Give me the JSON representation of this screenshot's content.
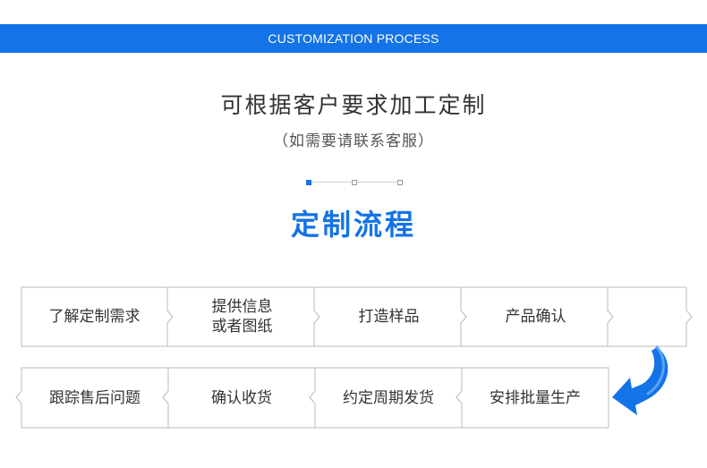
{
  "banner": {
    "label": "CUSTOMIZATION PROCESS"
  },
  "heading": {
    "title": "可根据客户要求加工定制",
    "subtitle": "（如需要请联系客服）"
  },
  "process": {
    "title": "定制流程",
    "row1": [
      {
        "label": "了解定制需求"
      },
      {
        "label": "提供信息\n或者图纸"
      },
      {
        "label": "打造样品"
      },
      {
        "label": "产品确认"
      },
      {
        "label": ""
      }
    ],
    "row2": [
      {
        "label": "跟踪售后问题"
      },
      {
        "label": "确认收货"
      },
      {
        "label": "约定周期发货"
      },
      {
        "label": "安排批量生产"
      }
    ]
  },
  "colors": {
    "accent": "#1473e6",
    "border": "#bbbbbb"
  },
  "icons": {
    "turn_arrow": "u-turn-arrow-icon"
  }
}
